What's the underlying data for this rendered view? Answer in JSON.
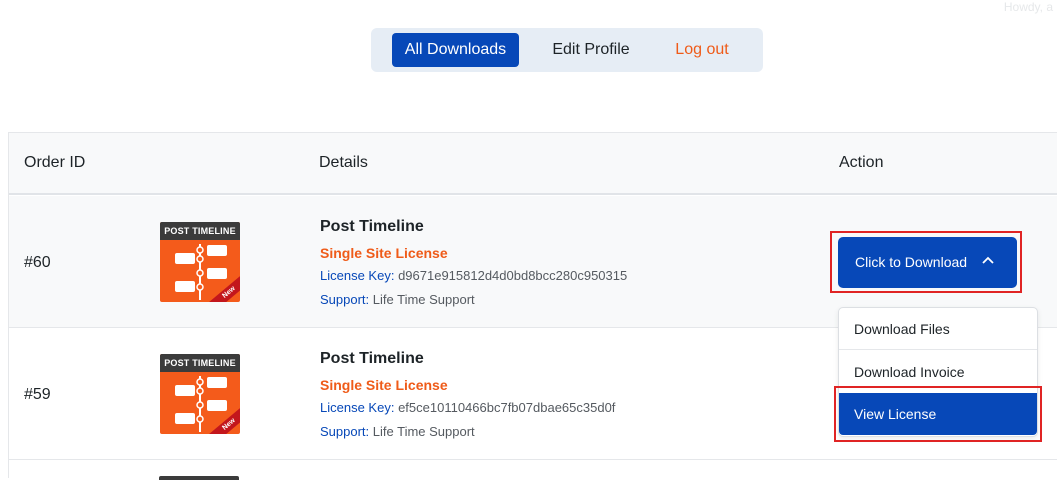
{
  "header": {
    "howdy": "Howdy, a"
  },
  "nav": {
    "tabs": [
      "All Downloads",
      "Edit Profile",
      "Log out"
    ]
  },
  "table": {
    "columns": [
      "Order ID",
      "Details",
      "Action"
    ],
    "rows": [
      {
        "order_id": "#60",
        "thumbnail_title": "POST TIMELINE",
        "thumbnail_badge": "New",
        "product": "Post Timeline",
        "license_type": "Single Site License",
        "license_key_label": "License Key:",
        "license_key": "d9671e915812d4d0bd8bcc280c950315",
        "support_label": "Support:",
        "support": "Life Time Support"
      },
      {
        "order_id": "#59",
        "thumbnail_title": "POST TIMELINE",
        "thumbnail_badge": "New",
        "product": "Post Timeline",
        "license_type": "Single Site License",
        "license_key_label": "License Key:",
        "license_key": "ef5ce10110466bc7fb07dbae65c35d0f",
        "support_label": "Support:",
        "support": "Life Time Support"
      }
    ]
  },
  "action": {
    "download_button": "Click to Download",
    "dropdown": [
      "Download Files",
      "Download Invoice",
      "View License"
    ],
    "selected_item": "View License"
  },
  "colors": {
    "primary": "#0748b8",
    "accent": "#ef5b19",
    "highlight": "#e02424"
  }
}
